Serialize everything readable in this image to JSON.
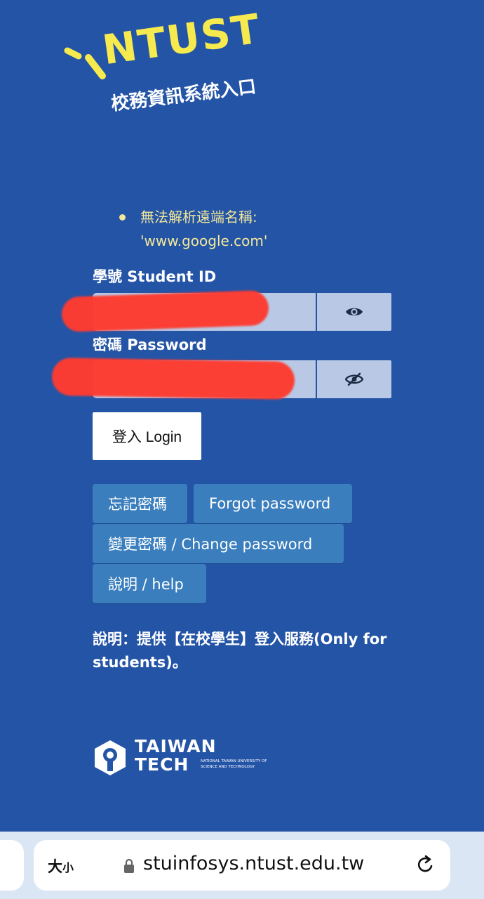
{
  "branding": {
    "logo_text": "NTUST",
    "portal_title": "校務資訊系統入口",
    "brand_yellow": "#f6ea4f"
  },
  "errors": [
    {
      "line1": "無法解析遠端名稱:",
      "line2": "'www.google.com'"
    }
  ],
  "login": {
    "student_id_label": "學號 Student ID",
    "student_id_value": "",
    "password_label": "密碼 Password",
    "password_value": "",
    "show_icon": "eye-icon",
    "hide_icon": "eye-slash-icon",
    "login_button": "登入 Login"
  },
  "links": {
    "forgot_zh": "忘記密碼",
    "forgot_en": "Forgot password",
    "change": "變更密碼 / Change password",
    "help": "說明 / help"
  },
  "note": "說明：提供【在校學生】登入服務(Only for students)。",
  "footer_logo": {
    "line1": "TAIWAN",
    "line2": "TECH",
    "small": "NATIONAL TAIWAN UNIVERSITY OF SCIENCE AND TECHNOLOGY"
  },
  "browser": {
    "text_size": "大",
    "text_size_small": "小",
    "url": "stuinfosys.ntust.edu.tw"
  },
  "colors": {
    "background": "#2454a6",
    "field": "#b9c8e4",
    "link_button": "#3a7ebd",
    "error_text": "#f2e79a"
  }
}
